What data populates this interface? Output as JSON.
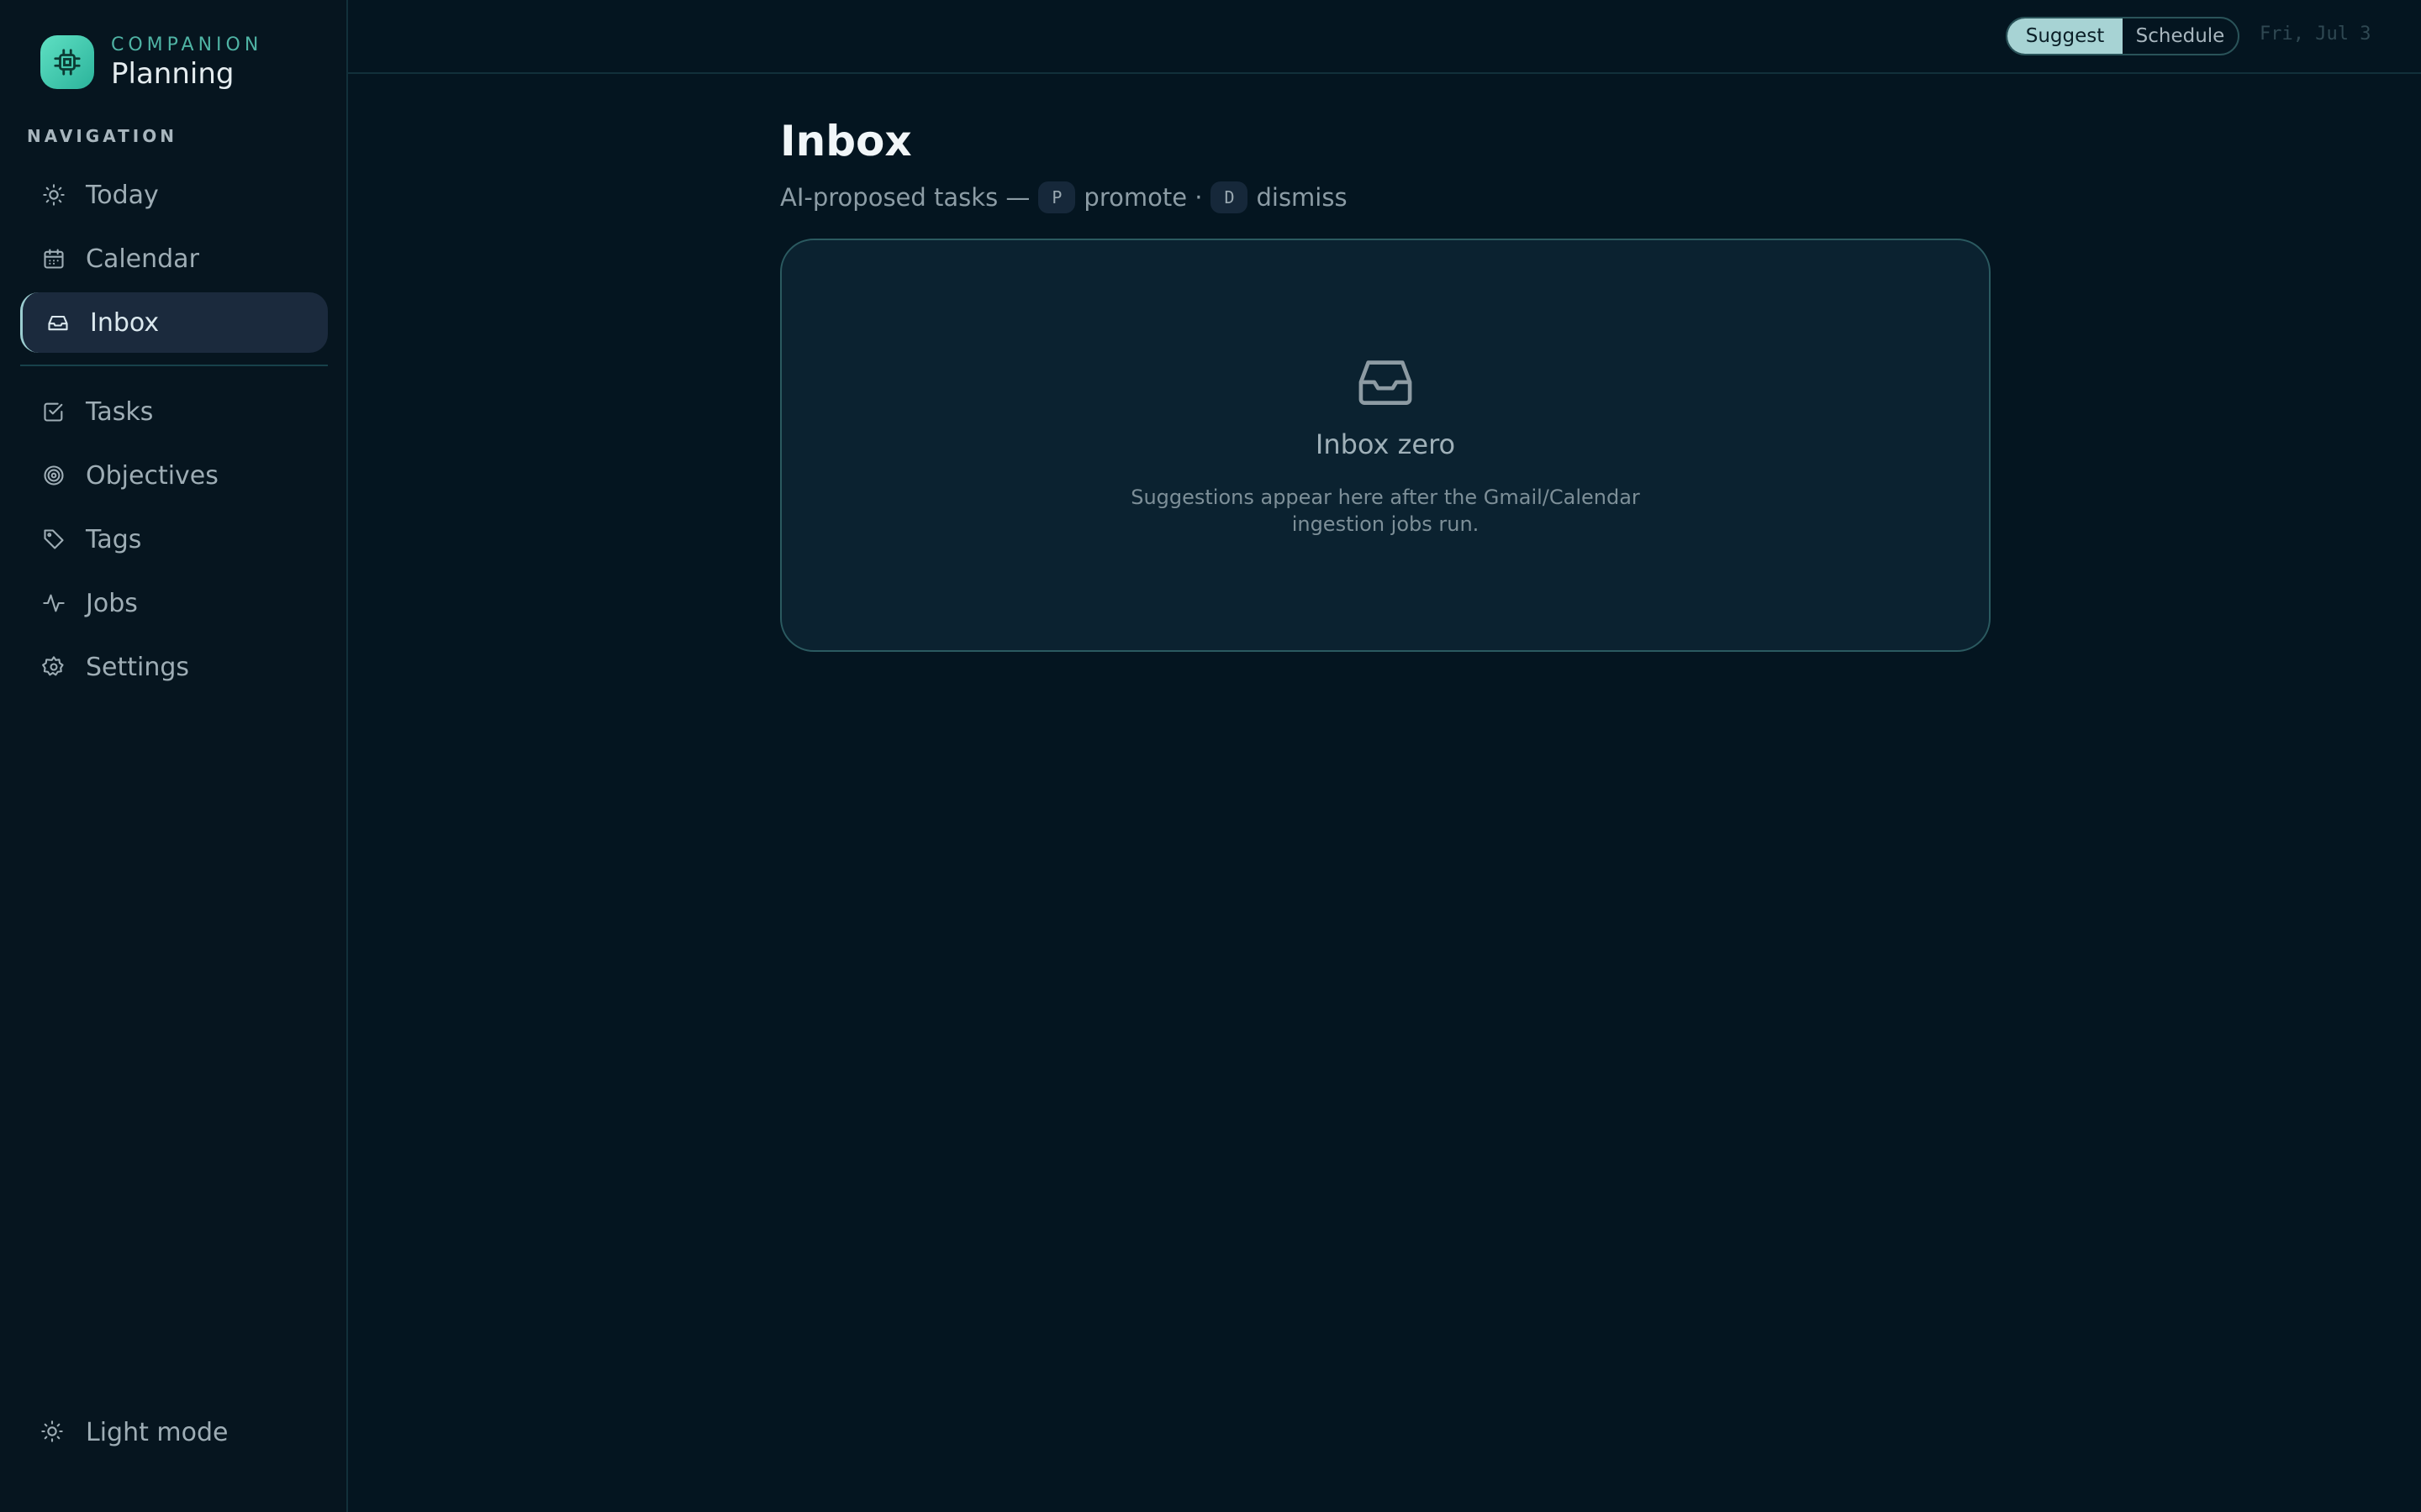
{
  "brand": {
    "eyebrow": "COMPANION",
    "title": "Planning"
  },
  "nav": {
    "heading": "NAVIGATION",
    "primary": [
      {
        "label": "Today",
        "icon": "sun-icon"
      },
      {
        "label": "Calendar",
        "icon": "calendar-icon"
      },
      {
        "label": "Inbox",
        "icon": "inbox-icon",
        "active": true
      }
    ],
    "secondary": [
      {
        "label": "Tasks",
        "icon": "checkbox-icon"
      },
      {
        "label": "Objectives",
        "icon": "target-icon"
      },
      {
        "label": "Tags",
        "icon": "tag-icon"
      },
      {
        "label": "Jobs",
        "icon": "activity-icon"
      },
      {
        "label": "Settings",
        "icon": "gear-icon"
      }
    ],
    "light_mode": "Light mode"
  },
  "topbar": {
    "toggle": [
      "Suggest",
      "Schedule"
    ],
    "active_toggle": "Suggest",
    "date": "Fri, Jul 3"
  },
  "page": {
    "title": "Inbox",
    "subtitle_prefix": "AI-proposed tasks —",
    "key_promote": "P",
    "promote_label": "promote ·",
    "key_dismiss": "D",
    "dismiss_label": "dismiss"
  },
  "empty_state": {
    "title": "Inbox zero",
    "description": "Suggestions appear here after the Gmail/Calendar ingestion jobs run."
  },
  "colors": {
    "accent": "#4fb3a4",
    "background": "#041520",
    "card": "#0b2230"
  }
}
